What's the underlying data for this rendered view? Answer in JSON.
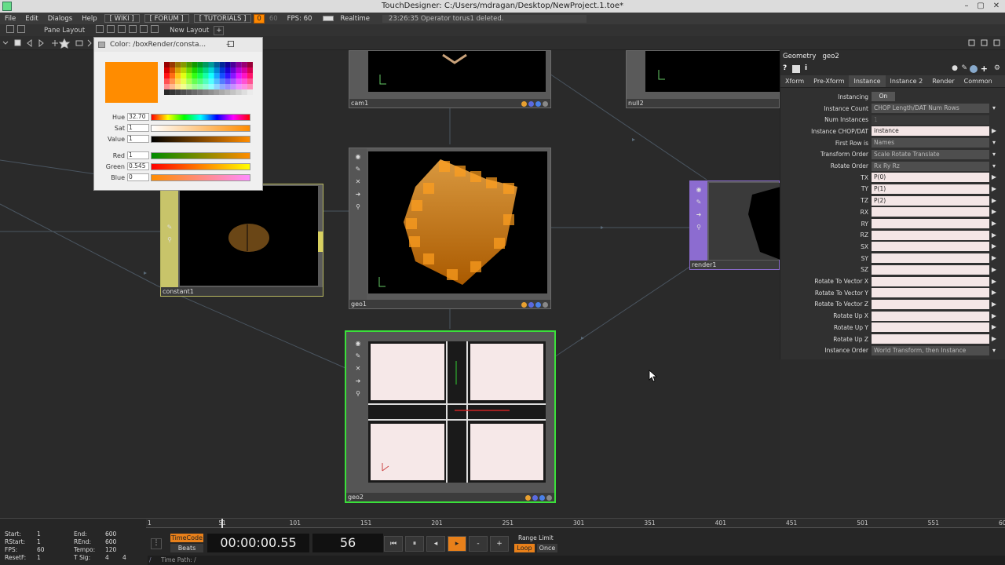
{
  "window": {
    "title": "TouchDesigner: C:/Users/mdragan/Desktop/NewProject.1.toe*",
    "minimize": "–",
    "maximize": "▢",
    "close": "✕"
  },
  "menu": {
    "items": [
      "File",
      "Edit",
      "Dialogs",
      "Help"
    ],
    "buttons": [
      "[ WIKI ]",
      "[ FORUM ]",
      "[ TUTORIALS ]"
    ],
    "og_a": "0",
    "og_b": "60",
    "fps_label": "FPS: 60",
    "realtime": "Realtime",
    "status_message": "23:26:35 Operator torus1 deleted."
  },
  "panebar": {
    "pane_layout": "Pane Layout",
    "new_layout": "New Layout",
    "add": "+"
  },
  "color_picker": {
    "title": "Color: /boxRender/consta...",
    "swatch_color": "#ff8c00",
    "rows": [
      {
        "name": "Hue",
        "value": "32.70"
      },
      {
        "name": "Sat",
        "value": "1"
      },
      {
        "name": "Value",
        "value": "1"
      },
      {
        "name": "Red",
        "value": "1"
      },
      {
        "name": "Green",
        "value": "0.545"
      },
      {
        "name": "Blue",
        "value": "0"
      }
    ]
  },
  "nodes": {
    "cam1": "cam1",
    "null2": "null2",
    "geo1": "geo1",
    "constant1": "constant1",
    "render1": "render1",
    "geo2": "geo2"
  },
  "params": {
    "op_type": "Geometry",
    "op_name": "geo2",
    "tabs": [
      "Xform",
      "Pre-Xform",
      "Instance",
      "Instance 2",
      "Render",
      "Common"
    ],
    "rows": [
      {
        "label": "Instancing",
        "value": "On",
        "kind": "toggle"
      },
      {
        "label": "Instance Count",
        "value": "CHOP Length/DAT Num Rows",
        "kind": "menu"
      },
      {
        "label": "Num Instances",
        "value": "1",
        "kind": "dim"
      },
      {
        "label": "Instance CHOP/DAT",
        "value": "instance",
        "kind": "field"
      },
      {
        "label": "First Row is",
        "value": "Names",
        "kind": "menu"
      },
      {
        "label": "Transform Order",
        "value": "Scale Rotate Translate",
        "kind": "menu"
      },
      {
        "label": "Rotate Order",
        "value": "Rx Ry Rz",
        "kind": "menu"
      },
      {
        "label": "TX",
        "value": "P(0)",
        "kind": "field"
      },
      {
        "label": "TY",
        "value": "P(1)",
        "kind": "field"
      },
      {
        "label": "TZ",
        "value": "P(2)",
        "kind": "field"
      },
      {
        "label": "RX",
        "value": "",
        "kind": "field"
      },
      {
        "label": "RY",
        "value": "",
        "kind": "field"
      },
      {
        "label": "RZ",
        "value": "",
        "kind": "field"
      },
      {
        "label": "SX",
        "value": "",
        "kind": "field"
      },
      {
        "label": "SY",
        "value": "",
        "kind": "field"
      },
      {
        "label": "SZ",
        "value": "",
        "kind": "field"
      },
      {
        "label": "Rotate To Vector X",
        "value": "",
        "kind": "field"
      },
      {
        "label": "Rotate To Vector Y",
        "value": "",
        "kind": "field"
      },
      {
        "label": "Rotate To Vector Z",
        "value": "",
        "kind": "field"
      },
      {
        "label": "Rotate Up X",
        "value": "",
        "kind": "field"
      },
      {
        "label": "Rotate Up Y",
        "value": "",
        "kind": "field"
      },
      {
        "label": "Rotate Up Z",
        "value": "",
        "kind": "field"
      },
      {
        "label": "Instance Order",
        "value": "World Transform, then Instance",
        "kind": "menu"
      }
    ]
  },
  "timeline": {
    "ticks": [
      "1",
      "51",
      "101",
      "151",
      "201",
      "251",
      "301",
      "351",
      "401",
      "451",
      "501",
      "551",
      "600"
    ],
    "start_label": "Start:",
    "start": "1",
    "rstart_label": "RStart:",
    "rstart": "1",
    "fps_label": "FPS:",
    "fps": "60",
    "resetf_label": "ResetF:",
    "resetf": "1",
    "end_label": "End:",
    "end": "600",
    "rend_label": "REnd:",
    "rend": "600",
    "tempo_label": "Tempo:",
    "tempo": "120",
    "tsig_label": "T Sig:",
    "tsig_a": "4",
    "tsig_b": "4",
    "timecode_btn": "TimeCode",
    "beats_btn": "Beats",
    "timecode": "00:00:00.55",
    "frame": "56",
    "range_limit": "Range Limit",
    "loop": "Loop",
    "once": "Once",
    "time_path": "Time Path: /",
    "transport": [
      "⏮",
      "⏸",
      "◂",
      "▸",
      "-",
      "+"
    ]
  }
}
